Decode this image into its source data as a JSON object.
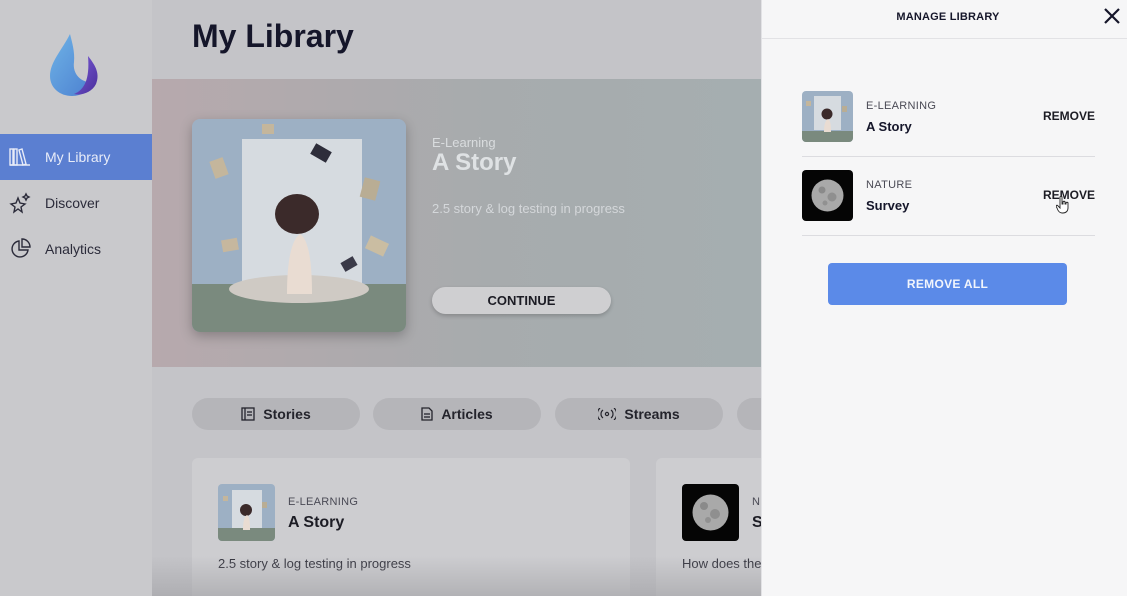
{
  "sidebar": {
    "items": [
      {
        "label": "My Library",
        "icon": "library-icon",
        "active": true
      },
      {
        "label": "Discover",
        "icon": "sparkle-star-icon"
      },
      {
        "label": "Analytics",
        "icon": "pie-chart-icon"
      }
    ]
  },
  "header": {
    "title": "My Library"
  },
  "hero": {
    "category": "E-Learning",
    "title": "A Story",
    "description": "2.5 story & log testing in progress",
    "continue_label": "CONTINUE"
  },
  "tabs": [
    {
      "label": "Stories",
      "icon": "book-icon"
    },
    {
      "label": "Articles",
      "icon": "document-icon"
    },
    {
      "label": "Streams",
      "icon": "broadcast-icon"
    },
    {
      "label": "",
      "icon": "more-tab"
    }
  ],
  "cards": [
    {
      "category": "E-LEARNING",
      "title": "A Story",
      "description": "2.5 story & log testing in progress"
    },
    {
      "category": "N",
      "title": "S",
      "description": "How does the"
    }
  ],
  "drawer": {
    "title": "MANAGE LIBRARY",
    "items": [
      {
        "category": "E-LEARNING",
        "title": "A Story",
        "action": "REMOVE"
      },
      {
        "category": "NATURE",
        "title": "Survey",
        "action": "REMOVE"
      }
    ],
    "remove_all_label": "REMOVE ALL"
  },
  "colors": {
    "accent": "#5b7fd1",
    "remove_all": "#5b8ae8",
    "title": "#15162a"
  }
}
